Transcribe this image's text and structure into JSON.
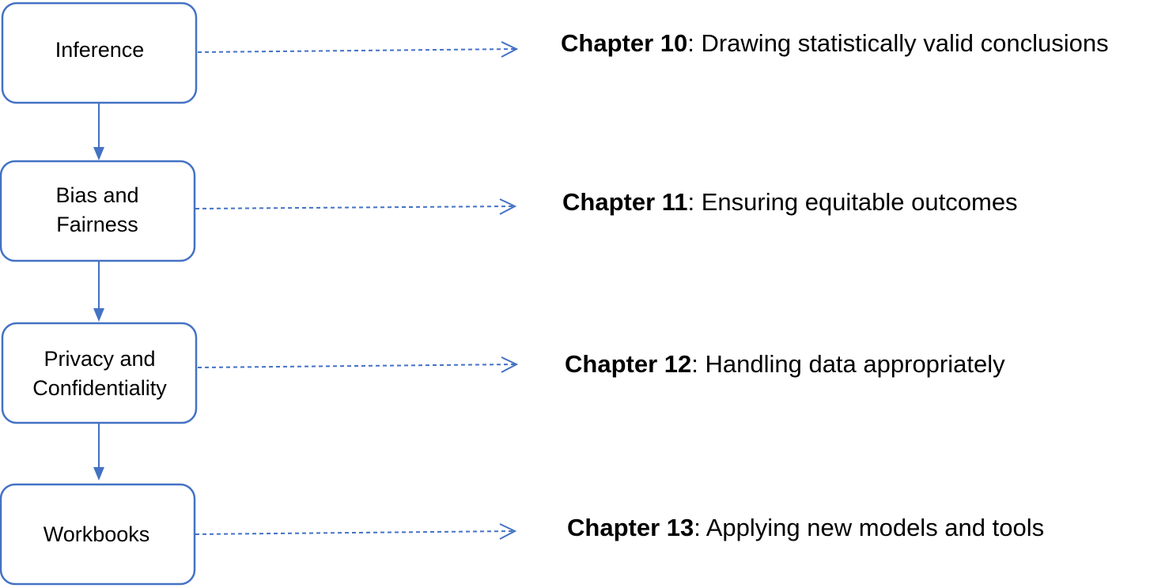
{
  "flow_boxes": [
    {
      "lines": [
        "Inference"
      ]
    },
    {
      "lines": [
        "Bias and",
        "Fairness"
      ]
    },
    {
      "lines": [
        "Privacy and",
        "Confidentiality"
      ]
    },
    {
      "lines": [
        "Workbooks"
      ]
    }
  ],
  "chapters": [
    {
      "number": "Chapter 10",
      "separator": ": ",
      "description": "Drawing statistically valid conclusions"
    },
    {
      "number": "Chapter 11",
      "separator": ": ",
      "description": "Ensuring equitable outcomes"
    },
    {
      "number": "Chapter 12",
      "separator": ": ",
      "description": "Handling data appropriately"
    },
    {
      "number": "Chapter 13",
      "separator": ": ",
      "description": "Applying new models and tools"
    }
  ],
  "colors": {
    "accent": "#4472C4",
    "text": "#000000",
    "background": "#ffffff"
  }
}
